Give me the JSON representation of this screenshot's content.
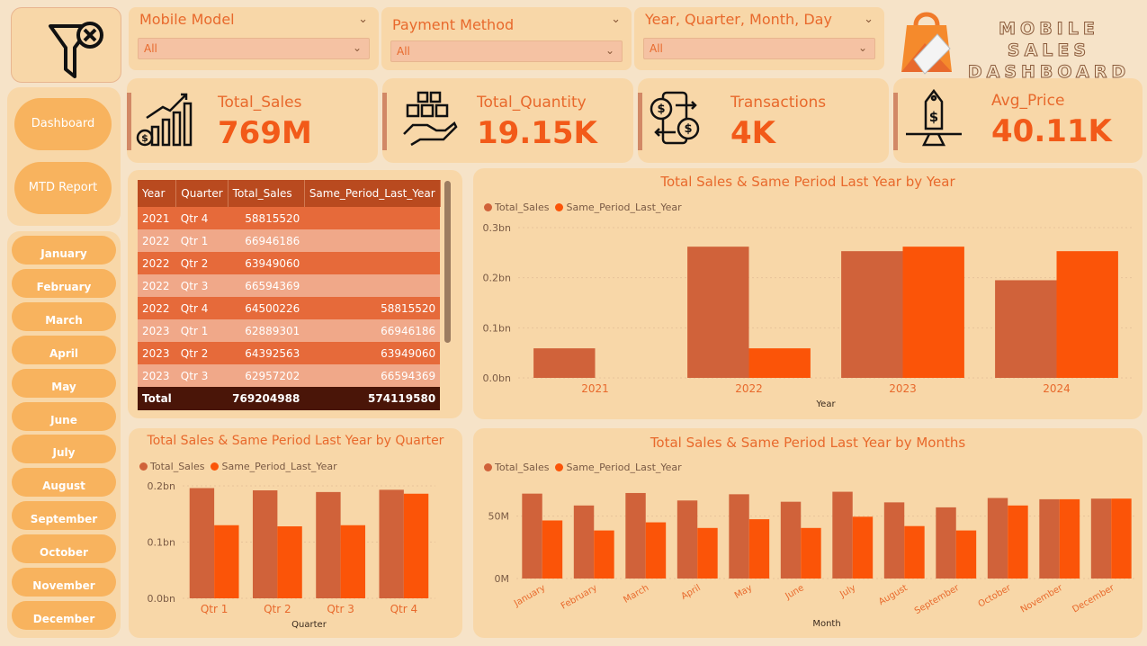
{
  "slicers": [
    {
      "title": "Mobile Model",
      "value": "All"
    },
    {
      "title": "Payment Method",
      "value": "All"
    },
    {
      "title": "Year, Quarter, Month, Day",
      "value": "All"
    }
  ],
  "brand": {
    "line1": "MOBILE SALES",
    "line2": "DASHBOARD"
  },
  "nav": {
    "dashboard": "Dashboard",
    "mtd": "MTD Report"
  },
  "months": [
    "January",
    "February",
    "March",
    "April",
    "May",
    "June",
    "July",
    "August",
    "September",
    "October",
    "November",
    "December"
  ],
  "kpis": [
    {
      "label": "Total_Sales",
      "value": "769M",
      "icon": "bar-growth-icon"
    },
    {
      "label": "Total_Quantity",
      "value": "19.15K",
      "icon": "boxes-hand-icon"
    },
    {
      "label": "Transactions",
      "value": "4K",
      "icon": "phone-dollar-exchange-icon"
    },
    {
      "label": "Avg_Price",
      "value": "40.11K",
      "icon": "price-tag-scale-icon"
    }
  ],
  "table": {
    "headers": [
      "Year",
      "Quarter",
      "Total_Sales",
      "Same_Period_Last_Year"
    ],
    "rows": [
      [
        "2021",
        "Qtr 4",
        "58815520",
        ""
      ],
      [
        "2022",
        "Qtr 1",
        "66946186",
        ""
      ],
      [
        "2022",
        "Qtr 2",
        "63949060",
        ""
      ],
      [
        "2022",
        "Qtr 3",
        "66594369",
        ""
      ],
      [
        "2022",
        "Qtr 4",
        "64500226",
        "58815520"
      ],
      [
        "2023",
        "Qtr 1",
        "62889301",
        "66946186"
      ],
      [
        "2023",
        "Qtr 2",
        "64392563",
        "63949060"
      ],
      [
        "2023",
        "Qtr 3",
        "62957202",
        "66594369"
      ]
    ],
    "total": [
      "Total",
      "",
      "769204988",
      "574119580"
    ]
  },
  "colors": {
    "total_sales": "#d0623a",
    "same_period": "#fb5408"
  },
  "legend": {
    "s1": "Total_Sales",
    "s2": "Same_Period_Last_Year"
  },
  "chart_data": [
    {
      "type": "bar",
      "title": "Total Sales & Same Period Last Year by Year",
      "xlabel": "Year",
      "ylabel": "",
      "categories": [
        "2021",
        "2022",
        "2023",
        "2024"
      ],
      "series": [
        {
          "name": "Total_Sales",
          "values": [
            0.059,
            0.262,
            0.253,
            0.195
          ]
        },
        {
          "name": "Same_Period_Last_Year",
          "values": [
            null,
            0.059,
            0.262,
            0.253
          ]
        }
      ],
      "yticks": [
        "0.0bn",
        "0.1bn",
        "0.2bn",
        "0.3bn"
      ],
      "ylim": [
        0,
        0.3
      ],
      "legend_position": "top-left"
    },
    {
      "type": "bar",
      "title": "Total Sales & Same Period Last Year by Quarter",
      "xlabel": "Quarter",
      "ylabel": "",
      "categories": [
        "Qtr 1",
        "Qtr 2",
        "Qtr 3",
        "Qtr 4"
      ],
      "series": [
        {
          "name": "Total_Sales",
          "values": [
            0.196,
            0.192,
            0.189,
            0.193
          ]
        },
        {
          "name": "Same_Period_Last_Year",
          "values": [
            0.13,
            0.128,
            0.13,
            0.186
          ]
        }
      ],
      "yticks": [
        "0.0bn",
        "0.1bn",
        "0.2bn"
      ],
      "ylim": [
        0,
        0.2
      ],
      "legend_position": "top-left"
    },
    {
      "type": "bar",
      "title": "Total Sales & Same Period Last Year by Months",
      "xlabel": "Month",
      "ylabel": "",
      "categories": [
        "January",
        "February",
        "March",
        "April",
        "May",
        "June",
        "July",
        "August",
        "September",
        "October",
        "November",
        "December"
      ],
      "series": [
        {
          "name": "Total_Sales",
          "values": [
            68,
            58.5,
            68.5,
            62.5,
            67.5,
            61.5,
            69.5,
            61,
            57,
            64.5,
            63.5,
            64
          ]
        },
        {
          "name": "Same_Period_Last_Year",
          "values": [
            46.5,
            38.5,
            45,
            40.5,
            47.5,
            40.5,
            49.5,
            42,
            38.5,
            58.5,
            63.5,
            64
          ]
        }
      ],
      "yticks": [
        "0M",
        "50M"
      ],
      "ylim": [
        0,
        80
      ],
      "legend_position": "top-left"
    }
  ]
}
